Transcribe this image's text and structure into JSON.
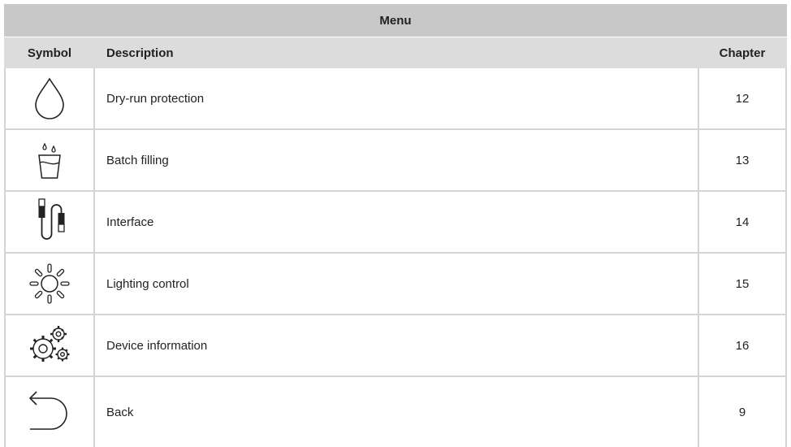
{
  "table": {
    "title": "Menu",
    "headers": {
      "symbol": "Symbol",
      "description": "Description",
      "chapter": "Chapter"
    },
    "rows": [
      {
        "icon": "drop-icon",
        "description": "Dry-run protection",
        "chapter": "12"
      },
      {
        "icon": "glass-filling-icon",
        "description": "Batch filling",
        "chapter": "13"
      },
      {
        "icon": "usb-cable-icon",
        "description": "Interface",
        "chapter": "14"
      },
      {
        "icon": "sun-icon",
        "description": "Lighting control",
        "chapter": "15"
      },
      {
        "icon": "gears-icon",
        "description": "Device information",
        "chapter": "16"
      },
      {
        "icon": "back-arrow-icon",
        "description": "Back",
        "chapter": "9"
      }
    ]
  }
}
